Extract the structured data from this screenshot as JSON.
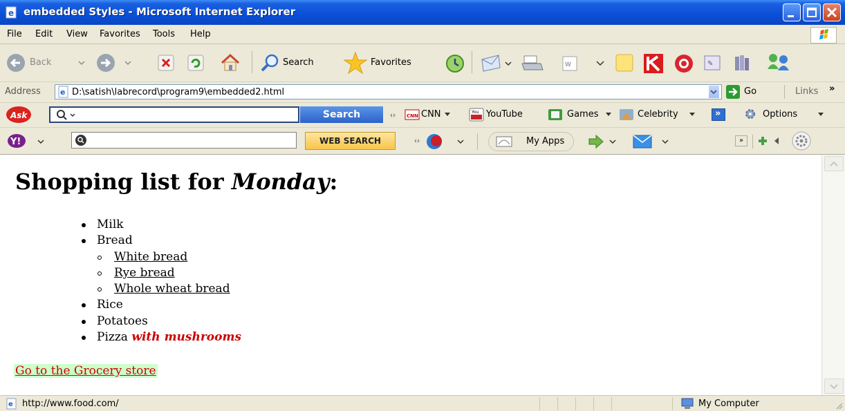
{
  "window": {
    "title": "embedded Styles - Microsoft Internet Explorer"
  },
  "menu": [
    "File",
    "Edit",
    "View",
    "Favorites",
    "Tools",
    "Help"
  ],
  "toolbar": {
    "back_label": "Back",
    "search_label": "Search",
    "favorites_label": "Favorites"
  },
  "address": {
    "label": "Address",
    "url": "D:\\satish\\labrecord\\program9\\embedded2.html",
    "go_label": "Go",
    "links_label": "Links"
  },
  "ask_toolbar": {
    "logo": "Ask",
    "search_button": "Search",
    "cnn_label": "CNN",
    "youtube_label": "YouTube",
    "games_label": "Games",
    "celebrity_label": "Celebrity",
    "options_label": "Options"
  },
  "yahoo_toolbar": {
    "logo": "Y!",
    "web_search_button": "WEB SEARCH",
    "myapps_label": "My Apps"
  },
  "page": {
    "heading_prefix": "Shopping list for ",
    "heading_emphasis": "Monday",
    "heading_suffix": ":",
    "items": [
      {
        "text": "Milk"
      },
      {
        "text": "Bread",
        "subitems": [
          "White bread",
          "Rye bread",
          "Whole wheat bread"
        ]
      },
      {
        "text": "Rice"
      },
      {
        "text": "Potatoes"
      },
      {
        "text": "Pizza",
        "emphasis": "with mushrooms"
      }
    ],
    "link_text": "Go to the Grocery store"
  },
  "status": {
    "url": "http://www.food.com/",
    "zone": "My Computer"
  },
  "colors": {
    "titlebar": "#0a4fd6",
    "chrome": "#ece9d8",
    "link_red": "#cc0000",
    "link_bg": "#ccffcc"
  }
}
